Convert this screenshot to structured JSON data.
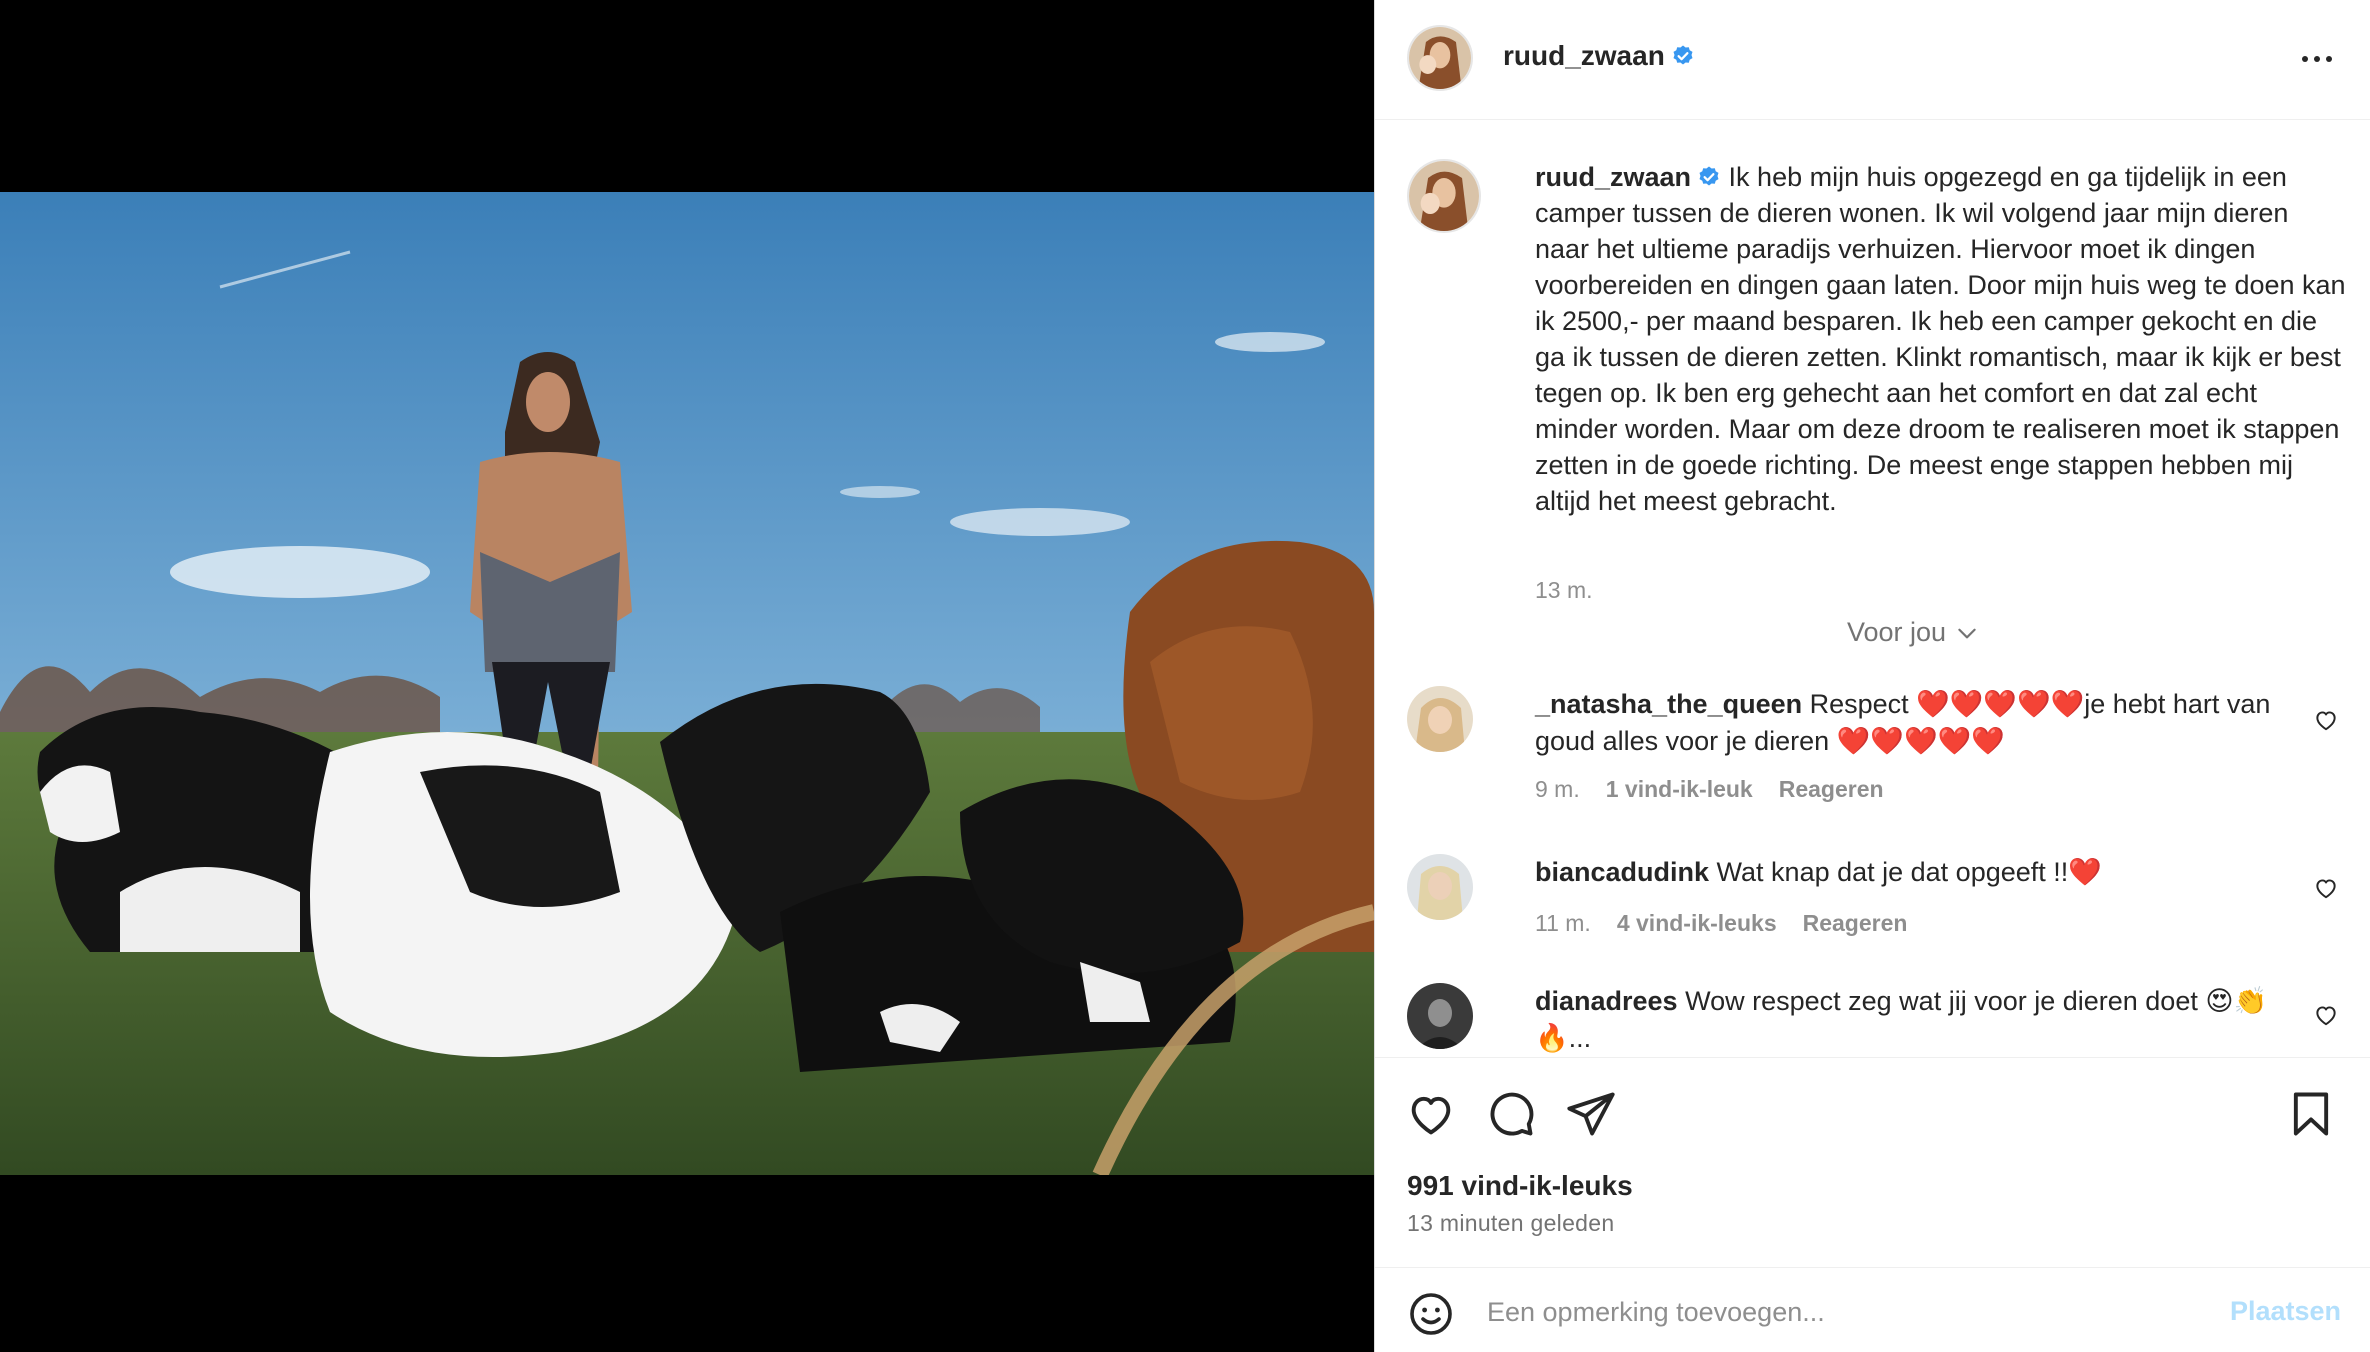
{
  "post": {
    "username": "ruud_zwaan",
    "verified": true,
    "caption": "Ik heb mijn huis opgezegd en ga tijdelijk in een camper tussen de dieren wonen. Ik wil volgend jaar mijn dieren naar het ultieme paradijs verhuizen. Hiervoor moet ik dingen voorbereiden en dingen gaan laten. Door mijn huis weg te doen kan ik 2500,- per maand besparen. Ik heb een camper gekocht en die ga ik tussen de dieren zetten. Klinkt romantisch, maar ik kijk er best tegen op. Ik ben erg gehecht aan het comfort en dat zal echt minder worden. Maar om deze droom te realiseren moet ik stappen zetten in de goede richting. De meest enge stappen hebben mij altijd het meest gebracht.",
    "caption_time": "13 m.",
    "for_you_label": "Voor jou",
    "likes_label": "991 vind-ik-leuks",
    "posted_ago": "13 minuten geleden"
  },
  "comments": [
    {
      "username": "_natasha_the_queen",
      "text_a": "Respect ",
      "hearts_a": "❤️❤️❤️❤️❤️",
      "text_b": "je hebt hart van goud alles voor je dieren ",
      "hearts_b": "❤️❤️❤️❤️❤️",
      "time": "9 m.",
      "likes": "1 vind-ik-leuk",
      "reply": "Reageren"
    },
    {
      "username": "biancadudink",
      "text_a": "Wat knap dat je dat opgeeft !!",
      "hearts_a": "❤️",
      "time": "11 m.",
      "likes": "4 vind-ik-leuks",
      "reply": "Reageren"
    },
    {
      "username": "dianadrees",
      "text_a": "Wow respect zeg wat jij voor je dieren doet 😍👏",
      "text_b": "🔥..."
    }
  ],
  "add_comment": {
    "placeholder": "Een opmerking toevoegen...",
    "post_label": "Plaatsen"
  },
  "icons": {
    "more": "more-horizontal-icon",
    "verified": "verified-badge-icon",
    "chevron": "chevron-down-icon",
    "like": "heart-outline-icon",
    "comment": "comment-bubble-icon",
    "share": "paper-plane-icon",
    "save": "bookmark-icon",
    "emoji": "smiley-icon"
  },
  "colors": {
    "verified": "#3897f0",
    "post_button_disabled": "#b2dffc",
    "secondary_text": "#8e8e8e"
  }
}
